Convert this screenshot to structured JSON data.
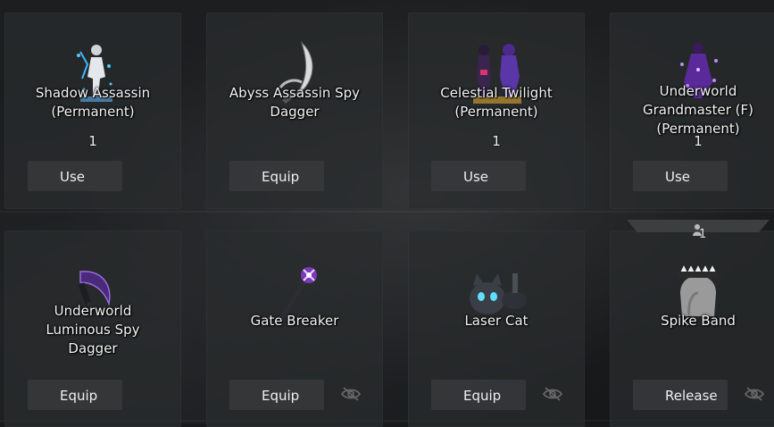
{
  "cards": [
    {
      "name_line1": "Shadow Assassin",
      "name_line2": "(Permanent)",
      "name_line3": "",
      "count": "1",
      "action": "Use",
      "icon": "shadow-assassin-costume-icon"
    },
    {
      "name_line1": "Abyss Assassin Spy",
      "name_line2": "Dagger",
      "name_line3": "",
      "count": "",
      "action": "Equip",
      "icon": "abyss-dagger-icon"
    },
    {
      "name_line1": "Celestial Twilight",
      "name_line2": "(Permanent)",
      "name_line3": "",
      "count": "1",
      "action": "Use",
      "icon": "celestial-twilight-costume-icon"
    },
    {
      "name_line1": "Underworld",
      "name_line2": "Grandmaster (F)",
      "name_line3": "(Permanent)",
      "count": "1",
      "action": "Use",
      "icon": "underworld-grandmaster-costume-icon"
    },
    {
      "name_line1": "Underworld",
      "name_line2": "Luminous Spy",
      "name_line3": "Dagger",
      "count": "",
      "action": "Equip",
      "icon": "luminous-dagger-icon"
    },
    {
      "name_line1": "Gate Breaker",
      "name_line2": "",
      "name_line3": "",
      "count": "",
      "action": "Equip",
      "icon": "gate-breaker-staff-icon"
    },
    {
      "name_line1": "Laser Cat",
      "name_line2": "",
      "name_line3": "",
      "count": "",
      "action": "Equip",
      "icon": "laser-cat-pet-icon"
    },
    {
      "name_line1": "Spike Band",
      "name_line2": "",
      "name_line3": "",
      "count": "",
      "action": "Release",
      "icon": "spike-band-headgear-icon"
    }
  ],
  "equipped_badge": {
    "count": "1",
    "icon": "character-icon"
  },
  "hidden_icons": [
    "eye-slash-icon",
    "eye-slash-icon",
    "eye-slash-icon"
  ],
  "colors": {
    "card": "#2a2c2e",
    "button": "#3a3c3e",
    "text": "#f2f2f2",
    "accent_purple": "#8a4fd8"
  }
}
